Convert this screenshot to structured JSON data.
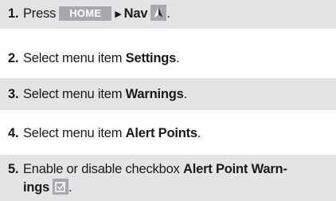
{
  "steps": [
    {
      "number": "1.",
      "press_text": "Press",
      "home_button": "HOME",
      "nav_label": "Nav",
      "nav_icon": "nav-arrow-icon",
      "end": "."
    },
    {
      "number": "2.",
      "text": "Select menu item",
      "item": "Settings",
      "end": "."
    },
    {
      "number": "3.",
      "text": "Select menu item",
      "item": "Warnings",
      "end": "."
    },
    {
      "number": "4.",
      "text": "Select menu item",
      "item": "Alert Points",
      "end": "."
    },
    {
      "number": "5.",
      "text": "Enable or disable checkbox",
      "item_line1": "Alert Point Warn-",
      "item_line2": "ings",
      "checkbox_icon": "checkbox-checked-icon",
      "end": "."
    }
  ],
  "colors": {
    "shade": "#e3e4e5",
    "button": "#a7aaad",
    "text": "#1a1a1a"
  }
}
